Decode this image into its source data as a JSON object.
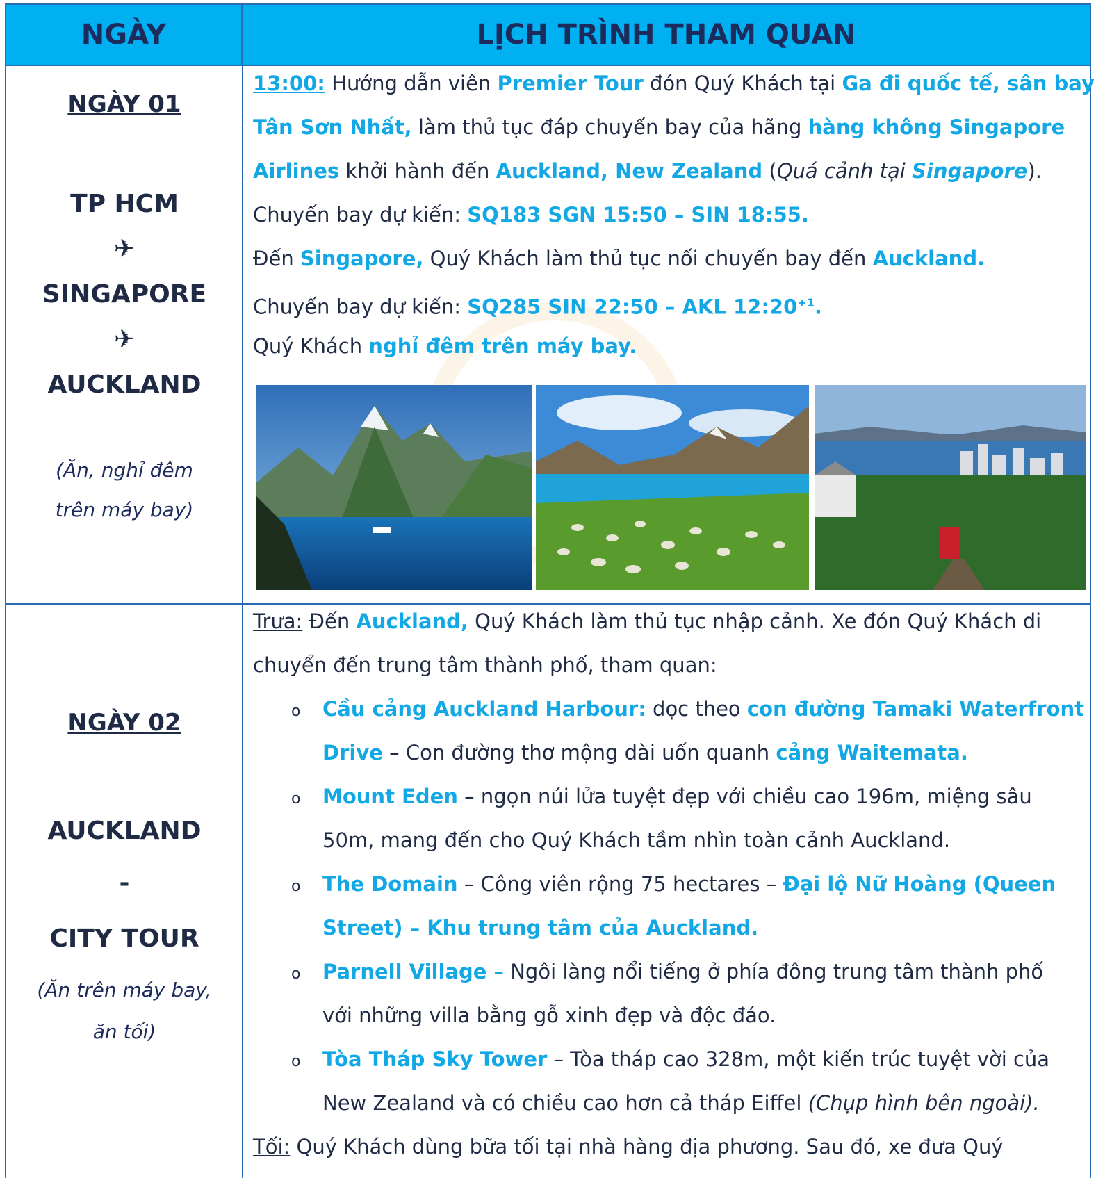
{
  "header": {
    "day_label": "NGÀY",
    "schedule_label": "LỊCH TRÌNH THAM QUAN"
  },
  "day1": {
    "title": "NGÀY 01",
    "places": [
      "TP HCM",
      "✈",
      "SINGAPORE",
      "✈",
      "AUCKLAND"
    ],
    "meal_note": [
      "(Ăn, nghỉ đêm",
      "trên máy bay)"
    ],
    "lines": {
      "l1_time": "13:00:",
      "l1_a": " Hướng dẫn viên ",
      "l1_b": "Premier Tour",
      "l1_c": " đón Quý Khách tại ",
      "l1_d": "Ga đi quốc tế, sân bay",
      "l2_a": "Tân Sơn Nhất,",
      "l2_b": " làm thủ tục đáp chuyến bay của hãng ",
      "l2_c": "hàng không Singapore",
      "l3_a": "Airlines",
      "l3_b": " khởi hành đến ",
      "l3_c": "Auckland, New Zealand",
      "l3_d": " (",
      "l3_e": "Quá cảnh tại ",
      "l3_f": "Singapore",
      "l3_g": ").",
      "l4_a": "Chuyến bay dự kiến: ",
      "l4_b": "SQ183 SGN 15:50 – SIN 18:55.",
      "l5_a": "Đến ",
      "l5_b": "Singapore,",
      "l5_c": " Quý Khách làm thủ tục nối chuyến bay đến ",
      "l5_d": "Auckland.",
      "l6_a": "Chuyến bay dự kiến: ",
      "l6_b": "SQ285 SIN 22:50 – AKL 12:20",
      "l6_sup": "+1",
      "l6_c": ".",
      "l7_a": "Quý Khách ",
      "l7_b": "nghỉ đêm trên máy bay."
    },
    "photos": [
      "fjord-mountains-photo",
      "lake-sheep-meadow-photo",
      "city-cable-car-photo"
    ]
  },
  "day2": {
    "title": "NGÀY 02",
    "places": [
      "AUCKLAND",
      "-",
      "CITY TOUR"
    ],
    "meal_note": [
      "(Ăn trên máy bay,",
      "ăn tối)"
    ],
    "intro_label": "Trưa:",
    "intro_a": " Đến ",
    "intro_b": "Auckland,",
    "intro_c": " Quý Khách làm thủ tục nhập cảnh. Xe đón Quý Khách di",
    "intro_d": "chuyển đến trung tâm thành phố, tham quan:",
    "bullet_char": "o",
    "items": [
      {
        "l1_a": "Cầu cảng Auckland Harbour:",
        "l1_b": " dọc theo ",
        "l1_c": "con đường Tamaki Waterfront",
        "l2_a": "Drive",
        "l2_b": " – Con đường thơ mộng dài uốn quanh ",
        "l2_c": "cảng Waitemata."
      },
      {
        "l1_a": "Mount Eden",
        "l1_b": " – ngọn núi lửa tuyệt đẹp với chiều cao 196m, miệng sâu",
        "l2_b": "50m, mang đến cho Quý Khách tầm nhìn toàn cảnh Auckland."
      },
      {
        "l1_a": "The Domain",
        "l1_b": " – Công viên rộng 75 hectares – ",
        "l1_c": "Đại lộ Nữ Hoàng (Queen",
        "l2_c": "Street) – Khu trung tâm của Auckland."
      },
      {
        "l1_a": "Parnell Village –",
        "l1_b": " Ngôi làng nổi tiếng ở phía đông trung tâm thành phố",
        "l2_b": "với những villa bằng gỗ xinh đẹp và độc đáo."
      },
      {
        "l1_a": "Tòa Tháp Sky Tower",
        "l1_b": " – Tòa tháp cao 328m, một kiến trúc tuyệt vời của",
        "l2_b": "New Zealand và có chiều cao hơn cả tháp Eiffel ",
        "l2_i": "(Chụp hình bên ngoài)."
      }
    ],
    "evening_label": "Tối:",
    "evening_text": " Quý Khách dùng bữa tối tại nhà hàng địa phương. Sau đó, xe đưa Quý"
  },
  "colors": {
    "header_bg": "#00b0f0",
    "highlight": "#12a8e6",
    "border": "#2a6bb5",
    "text": "#1f2a44"
  }
}
